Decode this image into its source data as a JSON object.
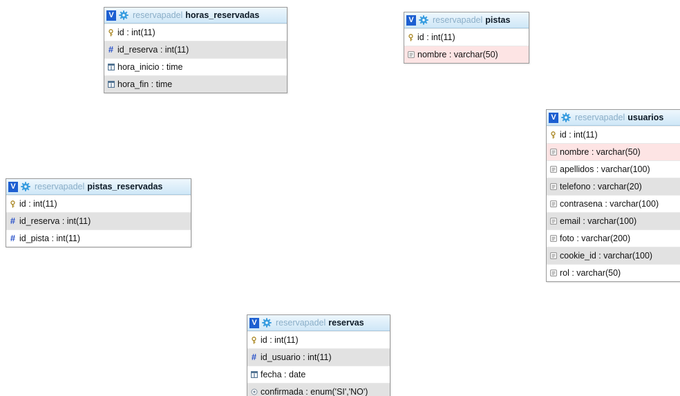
{
  "colors": {
    "v_button": "#1d5fd1",
    "header_gradient_top": "#eef7fd",
    "header_gradient_bottom": "#cfe7f7",
    "db_name": "#8aaec8",
    "row_alt": "#e2e2e2",
    "row_pink": "#fde4e4",
    "hash_icon": "#2a52c9"
  },
  "tables": [
    {
      "db": "reservapadel",
      "name": "horas_reservadas",
      "toggle": "V",
      "columns": [
        {
          "label": "id : int(11)",
          "icon": "key-icon",
          "bg": "white"
        },
        {
          "label": "id_reserva : int(11)",
          "icon": "hash-icon",
          "bg": "alt"
        },
        {
          "label": "hora_inicio : time",
          "icon": "calendar-icon",
          "bg": "white"
        },
        {
          "label": "hora_fin : time",
          "icon": "calendar-icon",
          "bg": "alt"
        }
      ]
    },
    {
      "db": "reservapadel",
      "name": "pistas",
      "toggle": "V",
      "columns": [
        {
          "label": "id : int(11)",
          "icon": "key-icon",
          "bg": "white"
        },
        {
          "label": "nombre : varchar(50)",
          "icon": "text-icon",
          "bg": "pink"
        }
      ]
    },
    {
      "db": "reservapadel",
      "name": "usuarios",
      "toggle": "V",
      "columns": [
        {
          "label": "id : int(11)",
          "icon": "key-icon",
          "bg": "white"
        },
        {
          "label": "nombre : varchar(50)",
          "icon": "text-icon",
          "bg": "pink"
        },
        {
          "label": "apellidos : varchar(100)",
          "icon": "text-icon",
          "bg": "white"
        },
        {
          "label": "telefono : varchar(20)",
          "icon": "text-icon",
          "bg": "alt"
        },
        {
          "label": "contrasena : varchar(100)",
          "icon": "text-icon",
          "bg": "white"
        },
        {
          "label": "email : varchar(100)",
          "icon": "text-icon",
          "bg": "alt"
        },
        {
          "label": "foto : varchar(200)",
          "icon": "text-icon",
          "bg": "white"
        },
        {
          "label": "cookie_id : varchar(100)",
          "icon": "text-icon",
          "bg": "alt"
        },
        {
          "label": "rol : varchar(50)",
          "icon": "text-icon",
          "bg": "white"
        }
      ]
    },
    {
      "db": "reservapadel",
      "name": "pistas_reservadas",
      "toggle": "V",
      "columns": [
        {
          "label": "id : int(11)",
          "icon": "key-icon",
          "bg": "white"
        },
        {
          "label": "id_reserva : int(11)",
          "icon": "hash-icon",
          "bg": "alt"
        },
        {
          "label": "id_pista : int(11)",
          "icon": "hash-icon",
          "bg": "white"
        }
      ]
    },
    {
      "db": "reservapadel",
      "name": "reservas",
      "toggle": "V",
      "columns": [
        {
          "label": "id : int(11)",
          "icon": "key-icon",
          "bg": "white"
        },
        {
          "label": "id_usuario : int(11)",
          "icon": "hash-icon",
          "bg": "alt"
        },
        {
          "label": "fecha : date",
          "icon": "calendar-icon",
          "bg": "white"
        },
        {
          "label": "confirmada : enum('SI','NO')",
          "icon": "enum-icon",
          "bg": "alt"
        }
      ]
    }
  ]
}
